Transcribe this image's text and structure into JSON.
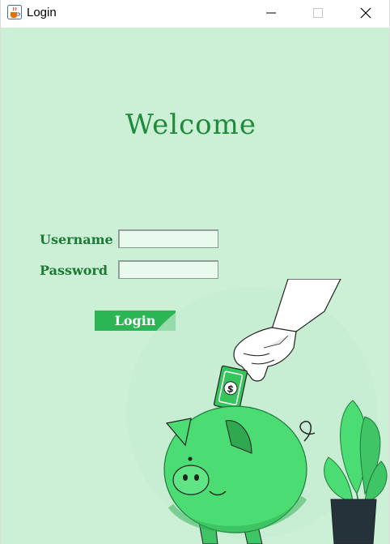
{
  "window": {
    "title": "Login"
  },
  "main": {
    "heading": "Welcome",
    "username_label": "Username",
    "username_value": "",
    "password_label": "Password",
    "password_value": "",
    "login_button_label": "Login"
  },
  "icons": {
    "app_icon": "java-cup-icon",
    "minimize": "minimize-icon",
    "maximize": "maximize-icon",
    "close": "close-icon",
    "illustration": "piggy-bank-savings-illustration"
  },
  "colors": {
    "background": "#cbf0d6",
    "heading": "#1f8a3a",
    "label": "#1c7a33",
    "button": "#2bb555",
    "field": "#e8faee",
    "piggy": "#4cdc74"
  }
}
